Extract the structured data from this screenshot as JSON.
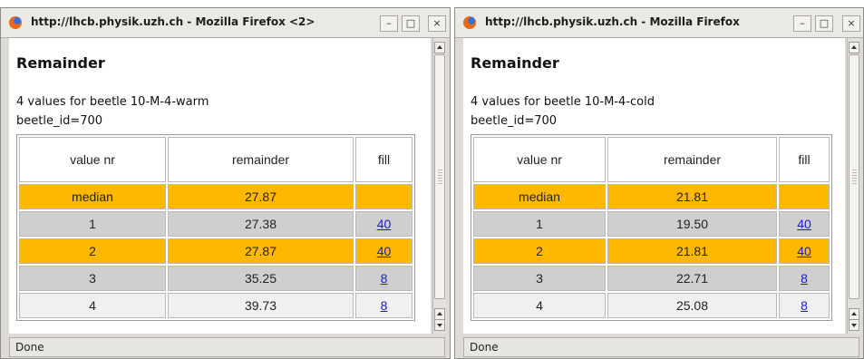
{
  "windows": [
    {
      "title": "http://lhcb.physik.uzh.ch - Mozilla Firefox <2>",
      "heading": "Remainder",
      "info_line": "4 values for beetle 10-M-4-warm",
      "beetle_line": "beetle_id=700",
      "columns": [
        "value nr",
        "remainder",
        "fill"
      ],
      "rows": [
        {
          "nr": "median",
          "remainder": "27.87",
          "fill": ""
        },
        {
          "nr": "1",
          "remainder": "27.38",
          "fill": "40"
        },
        {
          "nr": "2",
          "remainder": "27.87",
          "fill": "40"
        },
        {
          "nr": "3",
          "remainder": "35.25",
          "fill": "8"
        },
        {
          "nr": "4",
          "remainder": "39.73",
          "fill": "8"
        }
      ],
      "status": "Done"
    },
    {
      "title": "http://lhcb.physik.uzh.ch - Mozilla Firefox",
      "heading": "Remainder",
      "info_line": "4 values for beetle 10-M-4-cold",
      "beetle_line": "beetle_id=700",
      "columns": [
        "value nr",
        "remainder",
        "fill"
      ],
      "rows": [
        {
          "nr": "median",
          "remainder": "21.81",
          "fill": ""
        },
        {
          "nr": "1",
          "remainder": "19.50",
          "fill": "40"
        },
        {
          "nr": "2",
          "remainder": "21.81",
          "fill": "40"
        },
        {
          "nr": "3",
          "remainder": "22.71",
          "fill": "8"
        },
        {
          "nr": "4",
          "remainder": "25.08",
          "fill": "8"
        }
      ],
      "status": "Done"
    }
  ],
  "window_buttons": {
    "minimize": "–",
    "maximize": "□",
    "close": "×"
  },
  "colors": {
    "highlight": "#ffb800",
    "row_gray": "#cfcfcf",
    "row_light": "#f0f0f0",
    "link": "#1a1ad6"
  }
}
